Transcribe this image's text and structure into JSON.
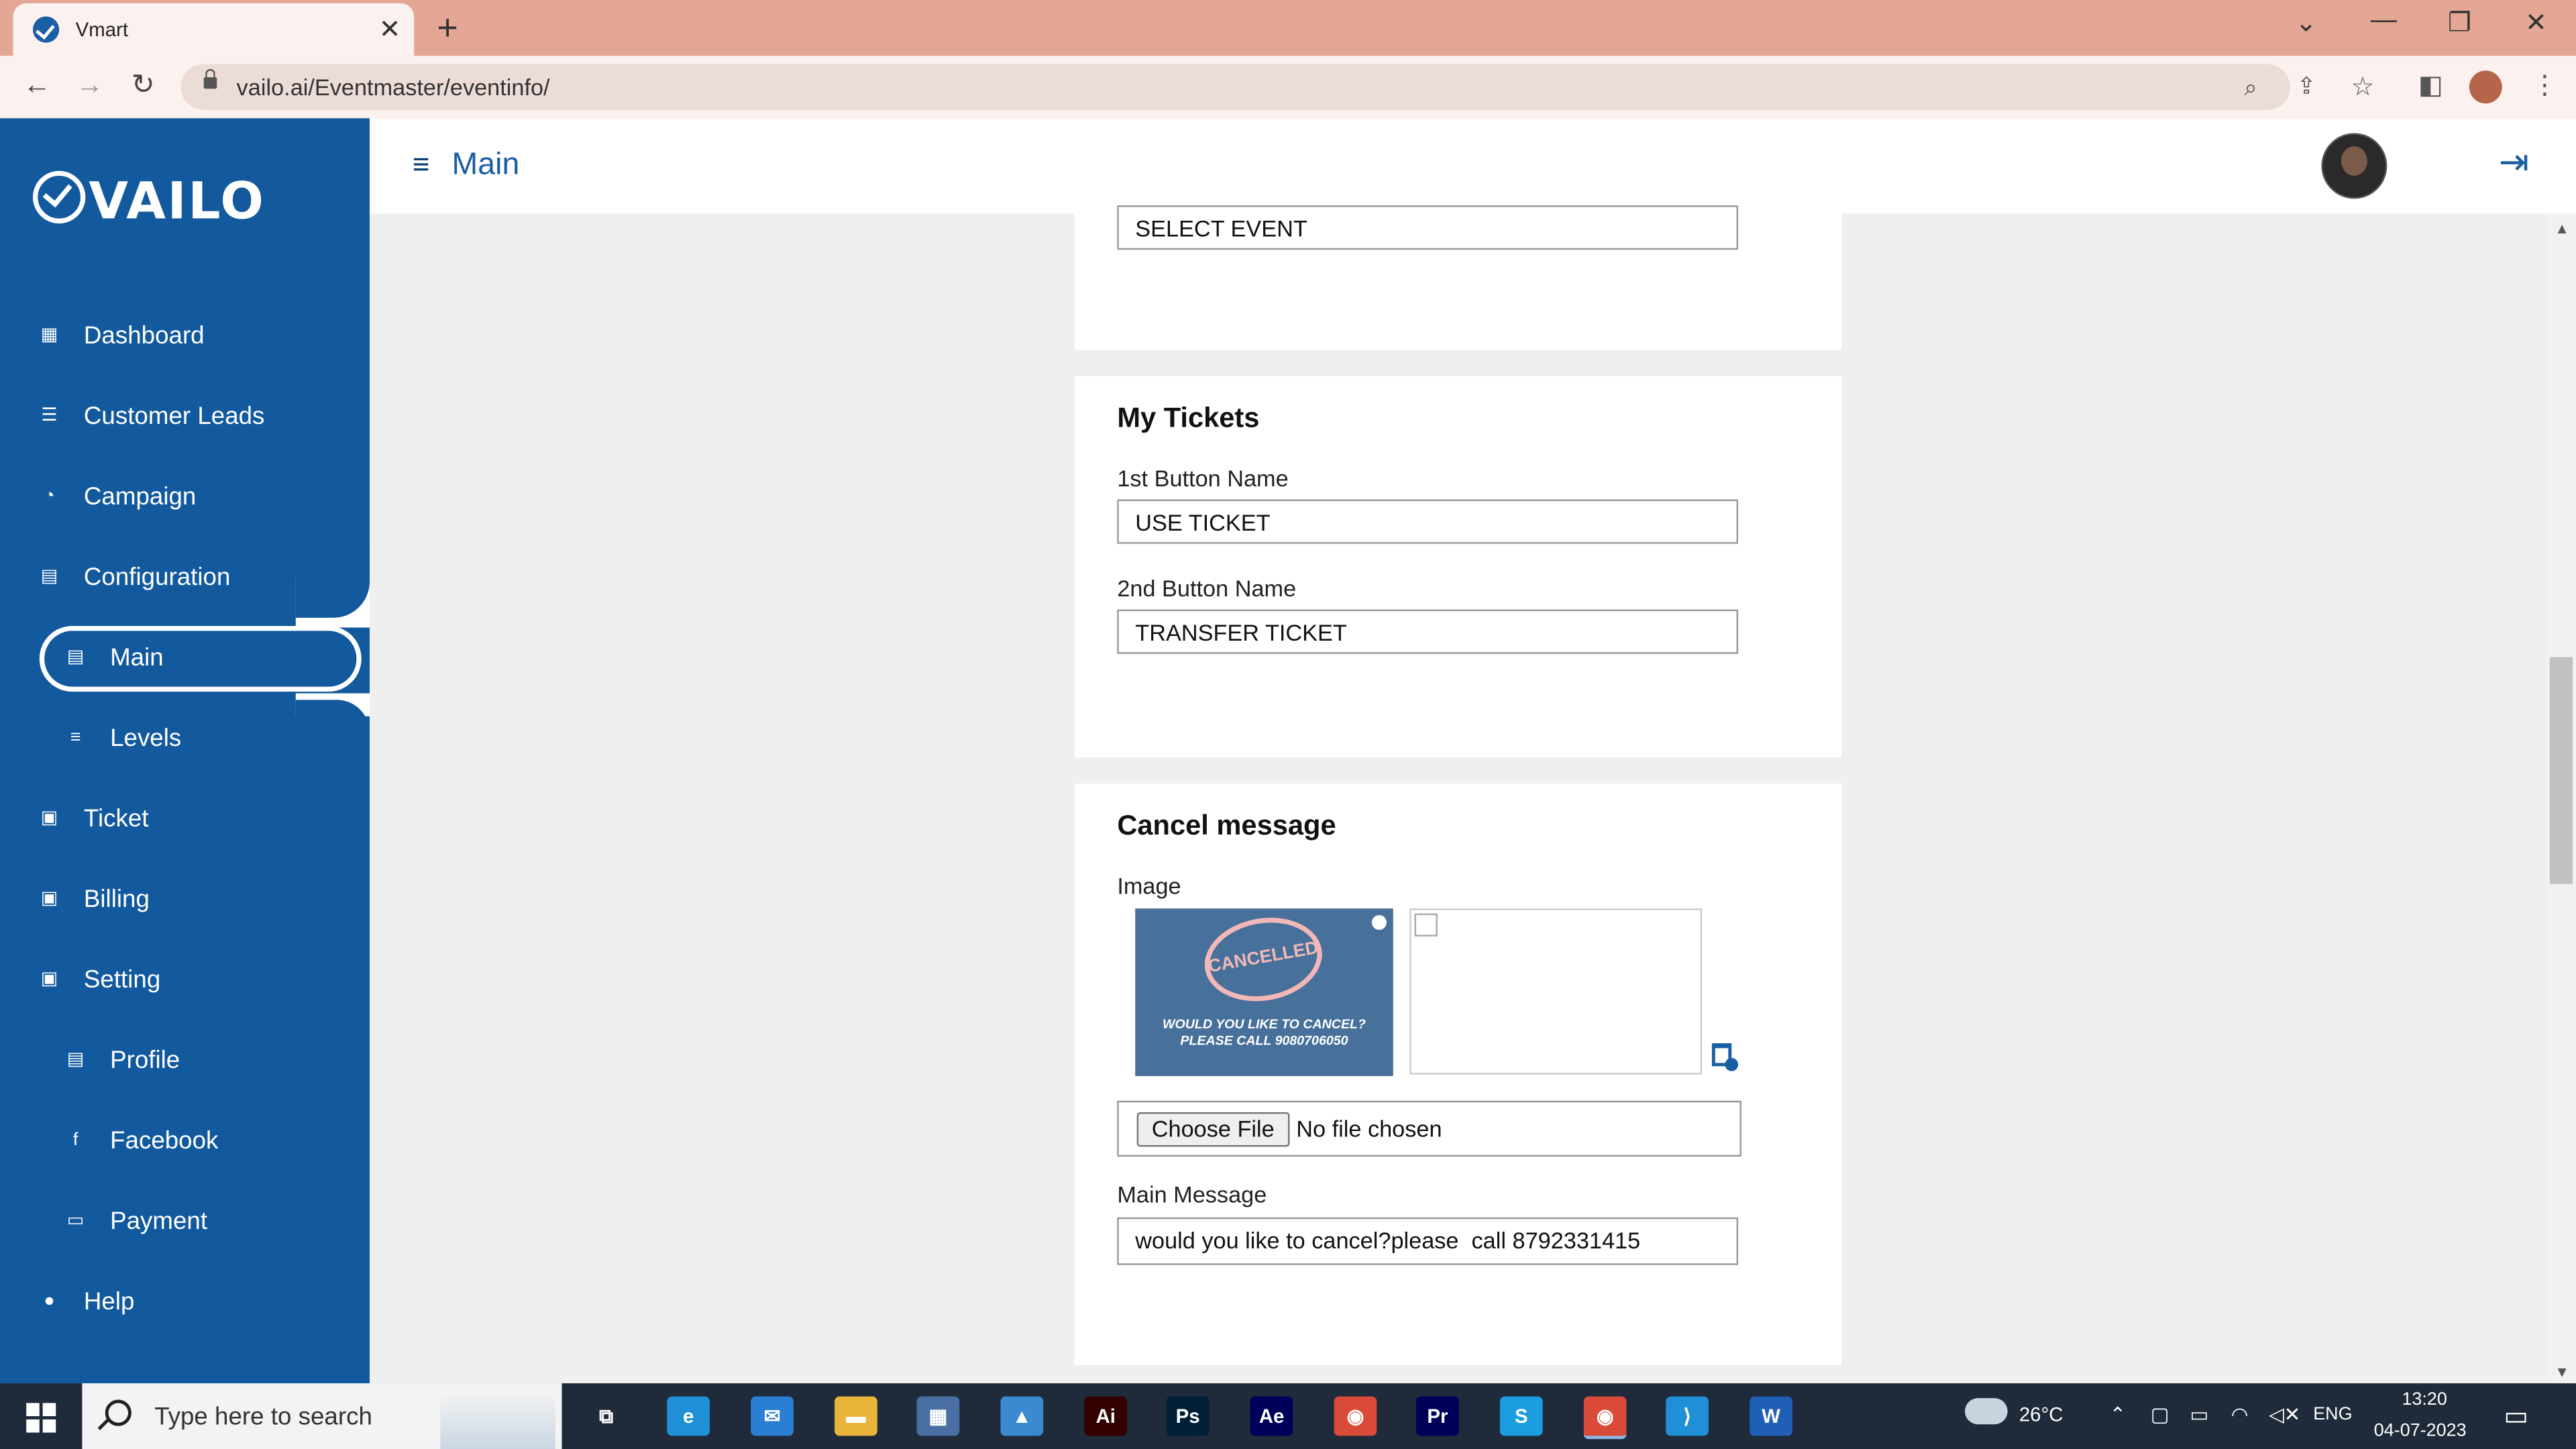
{
  "browser": {
    "tab_title": "Vmart",
    "tab_close": "✕",
    "new_tab": "+",
    "url": "vailo.ai/Eventmaster/eventinfo/",
    "window_controls": [
      "⌄",
      "—",
      "❐",
      "✕"
    ]
  },
  "app": {
    "logo_text": "VAILO",
    "page_title": "Main",
    "accent_color": "#12599e"
  },
  "sidebar": {
    "items": [
      {
        "label": "Dashboard",
        "icon": "dashboard-icon"
      },
      {
        "label": "Customer Leads",
        "icon": "users-icon"
      },
      {
        "label": "Campaign",
        "icon": "gauge-icon"
      },
      {
        "label": "Configuration",
        "icon": "document-icon"
      },
      {
        "label": "Main",
        "icon": "page-icon",
        "active": true
      },
      {
        "label": "Levels",
        "icon": "list-icon"
      },
      {
        "label": "Ticket",
        "icon": "chat-icon"
      },
      {
        "label": "Billing",
        "icon": "chat-icon"
      },
      {
        "label": "Setting",
        "icon": "chat-icon"
      },
      {
        "label": "Profile",
        "icon": "page-icon"
      },
      {
        "label": "Facebook",
        "icon": "facebook-icon"
      },
      {
        "label": "Payment",
        "icon": "wallet-icon"
      },
      {
        "label": "Help",
        "icon": "person-icon"
      }
    ]
  },
  "event_section": {
    "select_value": "SELECT EVENT"
  },
  "my_tickets": {
    "title": "My Tickets",
    "button1_label": "1st Button Name",
    "button1_value": "USE TICKET",
    "button2_label": "2nd Button Name",
    "button2_value": "TRANSFER TICKET"
  },
  "cancel_message": {
    "title": "Cancel message",
    "image_label": "Image",
    "image_stamp_text": "CANCELLED",
    "image_caption_line1": "WOULD YOU LIKE TO CANCEL?",
    "image_caption_line2": "PLEASE CALL 9080706050",
    "choose_file_label": "Choose File",
    "no_file_text": "No file chosen",
    "main_message_label": "Main Message",
    "main_message_value": "would you like to cancel?please  call 8792331415"
  },
  "taskbar": {
    "search_placeholder": "Type here to search",
    "apps": [
      {
        "name": "task-view-icon",
        "glyph": "⧉",
        "color": "#1f2b3a"
      },
      {
        "name": "edge-icon",
        "glyph": "e",
        "color": "#1f8fd6"
      },
      {
        "name": "mail-icon",
        "glyph": "✉",
        "color": "#2a7fd4"
      },
      {
        "name": "file-explorer-icon",
        "glyph": "▬",
        "color": "#e8b53a"
      },
      {
        "name": "store-icon",
        "glyph": "▦",
        "color": "#4a6fa5"
      },
      {
        "name": "photos-icon",
        "glyph": "▲",
        "color": "#3b8ad0"
      },
      {
        "name": "illustrator-icon",
        "glyph": "Ai",
        "color": "#330000"
      },
      {
        "name": "photoshop-icon",
        "glyph": "Ps",
        "color": "#001e36"
      },
      {
        "name": "after-effects-icon",
        "glyph": "Ae",
        "color": "#00005b"
      },
      {
        "name": "chrome-icon",
        "glyph": "◉",
        "color": "#d94a38"
      },
      {
        "name": "premiere-icon",
        "glyph": "Pr",
        "color": "#00005b"
      },
      {
        "name": "skype-icon",
        "glyph": "S",
        "color": "#1c9de0"
      },
      {
        "name": "chrome-active-icon",
        "glyph": "◉",
        "color": "#d94a38"
      },
      {
        "name": "vscode-icon",
        "glyph": "⟩",
        "color": "#1f8fd6"
      },
      {
        "name": "word-icon",
        "glyph": "W",
        "color": "#1f5fb5"
      }
    ],
    "weather": "26°C",
    "language": "ENG",
    "time": "13:20",
    "date": "04-07-2023"
  }
}
